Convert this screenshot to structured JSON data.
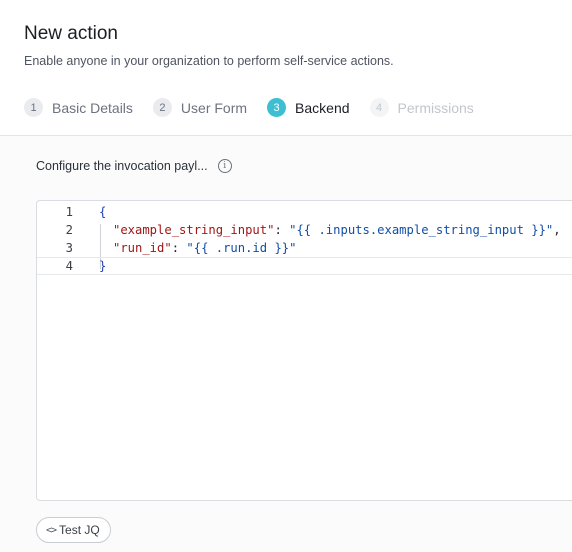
{
  "header": {
    "title": "New action",
    "subtitle": "Enable anyone in your organization to perform self-service actions."
  },
  "steps": [
    {
      "number": "1",
      "label": "Basic Details",
      "state": "completed"
    },
    {
      "number": "2",
      "label": "User Form",
      "state": "completed"
    },
    {
      "number": "3",
      "label": "Backend",
      "state": "active"
    },
    {
      "number": "4",
      "label": "Permissions",
      "state": "disabled"
    }
  ],
  "backend": {
    "config_label": "Configure the invocation payl...",
    "info_icon": "info-icon",
    "editor": {
      "lines": [
        {
          "num": "1",
          "open": "{"
        },
        {
          "num": "2",
          "key": "\"example_string_input\"",
          "sep": ": ",
          "value": "\"{{ .inputs.example_string_input }}\"",
          "trail": ","
        },
        {
          "num": "3",
          "key": "\"run_id\"",
          "sep": ": ",
          "value": "\"{{ .run.id }}\"",
          "trail": ""
        },
        {
          "num": "4",
          "close": "}"
        }
      ]
    },
    "test_button": {
      "icon": "<>",
      "label": "Test JQ"
    }
  },
  "colors": {
    "accent": "#3dbfd1",
    "key": "#a31515",
    "string": "#0f4fa8"
  }
}
